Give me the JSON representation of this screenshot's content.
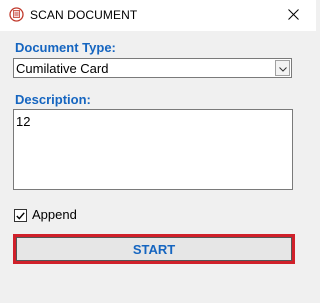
{
  "window": {
    "title": "SCAN DOCUMENT",
    "app_icon": "scanner-app-icon",
    "close_icon": "close-icon"
  },
  "form": {
    "document_type_label": "Document Type:",
    "document_type_value": "Cumilative Card",
    "description_label": "Description:",
    "description_value": "12",
    "append_label": "Append",
    "append_checked": true,
    "start_label": "START"
  },
  "colors": {
    "label_blue": "#1565c0",
    "focus_red": "#d0202a",
    "background": "#f0f0f0"
  }
}
